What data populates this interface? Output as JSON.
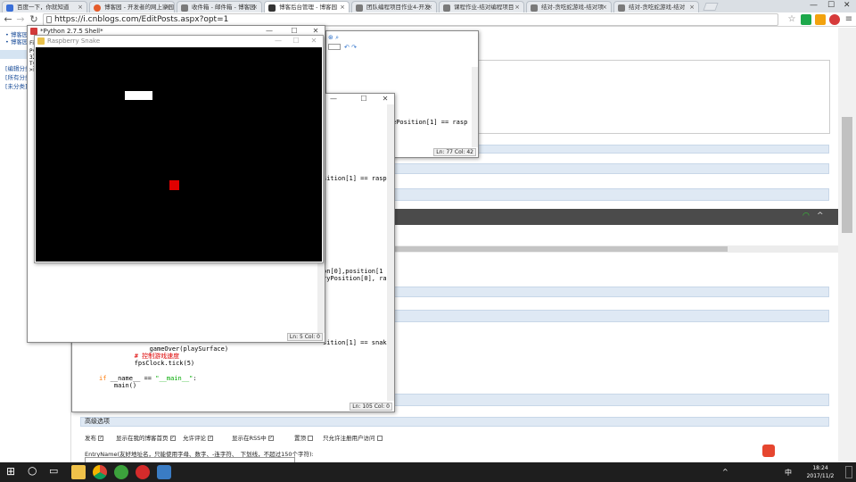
{
  "browser": {
    "tabs": [
      {
        "label": "百度一下，你就知道",
        "color": "#3a6fd8"
      },
      {
        "label": "博客园 - 开发者的网上家园",
        "color": "#e55b2a"
      },
      {
        "label": "收件箱 - 邮件箱 - 博客园",
        "color": "#7a7a7a"
      },
      {
        "label": "博客后台管理 - 博客园",
        "color": "#333333"
      },
      {
        "label": "团队编程项目作业4-开发",
        "color": "#7a7a7a"
      },
      {
        "label": "课程作业-结对编程项目",
        "color": "#7a7a7a"
      },
      {
        "label": "结对-贪吃蛇游戏-结对项",
        "color": "#7a7a7a"
      },
      {
        "label": "结对-贪吃蛇游戏-结对",
        "color": "#7a7a7a"
      }
    ],
    "active_tab_index": 3,
    "url": "https://i.cnblogs.com/EditPosts.aspx?opt=1",
    "back_glyph": "←",
    "forward_glyph": "→",
    "reload_glyph": "↻",
    "tab_close_glyph": "×",
    "star_glyph": "☆",
    "menu_glyph": "≡"
  },
  "leftnav": {
    "items": [
      "• 博客园",
      "• 博客园",
      "[编辑分类]",
      "[所有分类]",
      "[未分类]"
    ],
    "category_label": "分"
  },
  "editor": {
    "advanced_options_label": "高级选项",
    "options": [
      {
        "label": "发布",
        "checked": true
      },
      {
        "label": "显示在我的博客首页",
        "checked": true
      },
      {
        "label": "允许评论",
        "checked": true
      },
      {
        "label": "显示在RSS中",
        "checked": true
      },
      {
        "label": "置顶",
        "checked": false
      },
      {
        "label": "只允许注册用户访问",
        "checked": false
      }
    ],
    "entry_name_hint": "EntryName(友好地址名，只能使用字母、数字、-连字符、_下划线，不超过150个字符):"
  },
  "python_shell": {
    "title": "*Python 2.7.5 Shell*",
    "menu_label": "File",
    "lines": [
      "Py",
      "32",
      "Ty",
      ">>"
    ],
    "status": "Ln: 5 Col: 0",
    "minimize": "—",
    "maximize": "☐",
    "close": "✕"
  },
  "snake_window": {
    "title": "Raspberry Snake",
    "minimize": "—",
    "maximize": "☐",
    "close": "✕",
    "background": "#000000",
    "snake_color": "#ffffff",
    "raspberry_color": "#e00000"
  },
  "editor_window_top": {
    "code_line": "ePosition[1] == rasp",
    "status": "Ln: 77 Col: 42"
  },
  "editor_window_mid": {
    "minimize": "—",
    "maximize": "☐",
    "close": "✕",
    "status": "Ln: 105 Col: 0",
    "fragment_1": "sition[1] == rasp",
    "fragment_2": "on[0],position[1",
    "fragment_3": "ryPosition[0], ra",
    "fragment_4": "sition[1] == snak",
    "code_game_over": "            gameOver(playSurface)",
    "code_comment": "        # 控制游戏速度",
    "code_tick": "        fpsClock.tick(5)",
    "code_if_kw": "if",
    "code_if_rest": " __name__ == ",
    "code_if_str": "\"__main__\"",
    "code_if_end": ":",
    "code_main": "    main()"
  },
  "taskbar": {
    "time": "18:24",
    "date": "2017/11/2",
    "ime": "中",
    "start_glyph": "⊞",
    "search_glyph": "○",
    "taskview_glyph": "▭",
    "tray_up_glyph": "^"
  }
}
